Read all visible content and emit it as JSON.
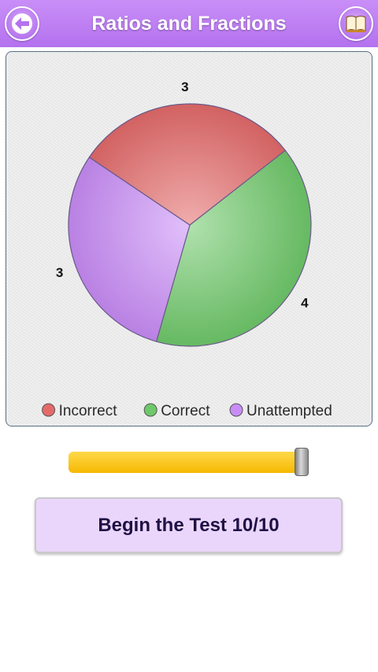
{
  "header": {
    "title": "Ratios and Fractions",
    "back_icon": "back-arrow-icon",
    "book_icon": "book-icon"
  },
  "chart_data": {
    "type": "pie",
    "categories": [
      "Incorrect",
      "Correct",
      "Unattempted"
    ],
    "values": [
      3,
      4,
      3
    ],
    "colors": [
      "#e46a6a",
      "#6fc96a",
      "#c98cf7"
    ],
    "legend_placement": "bottom",
    "data_labels": [
      "3",
      "4",
      "3"
    ]
  },
  "progress": {
    "value": 1.0
  },
  "begin_button": {
    "label": "Begin the Test 10/10"
  }
}
